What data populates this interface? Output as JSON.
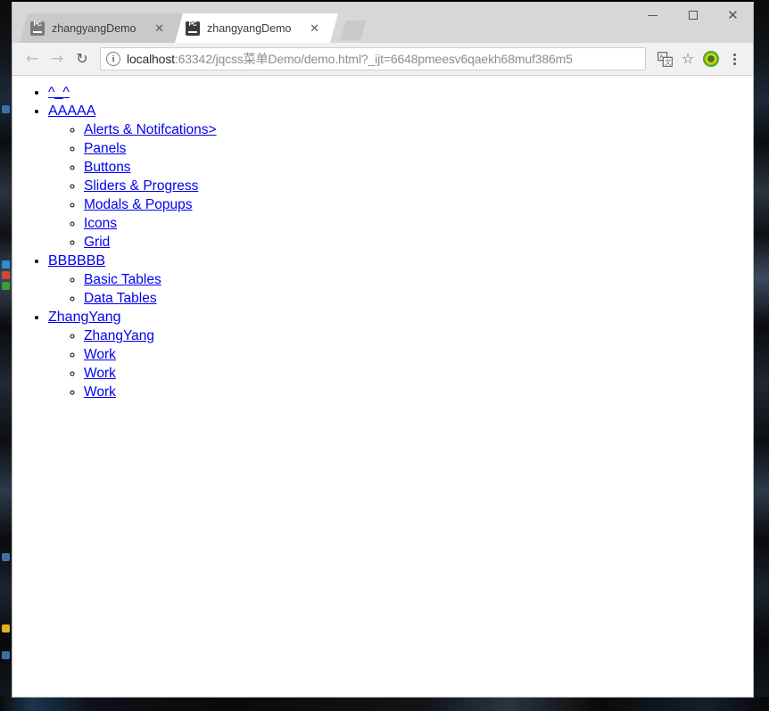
{
  "window": {
    "controls": {
      "minimize_label": "Minimize",
      "maximize_label": "Maximize",
      "close_label": "Close",
      "close_glyph": "✕"
    }
  },
  "tabstrip": {
    "tabs": [
      {
        "title": "zhangyangDemo",
        "favicon": "pycharm-icon",
        "close_glyph": "✕",
        "active": false
      },
      {
        "title": "zhangyangDemo",
        "favicon": "pycharm-icon",
        "close_glyph": "✕",
        "active": true
      }
    ],
    "new_tab_label": "New Tab"
  },
  "toolbar": {
    "back_glyph": "←",
    "forward_glyph": "→",
    "reload_glyph": "↻",
    "site_info_glyph": "i",
    "url_host": "localhost",
    "url_path": ":63342/jqcss菜单Demo/demo.html?_ijt=6648pmeesv6qaekh68muf386m5",
    "url_full": "localhost:63342/jqcss菜单Demo/demo.html?_ijt=6648pmeesv6qaekh68muf386m5",
    "translate_label": "Translate this page",
    "bookmark_glyph": "☆",
    "extension_label": "Extension",
    "menu_label": "Customize and control Google Chrome"
  },
  "page": {
    "menu": [
      {
        "label": "^_^",
        "children": []
      },
      {
        "label": "AAAAA",
        "children": [
          {
            "label": "Alerts & Notifcations>"
          },
          {
            "label": "Panels"
          },
          {
            "label": "Buttons"
          },
          {
            "label": "Sliders & Progress"
          },
          {
            "label": "Modals & Popups"
          },
          {
            "label": "Icons"
          },
          {
            "label": "Grid"
          }
        ]
      },
      {
        "label": "BBBBBB",
        "children": [
          {
            "label": "Basic Tables"
          },
          {
            "label": "Data Tables"
          }
        ]
      },
      {
        "label": "ZhangYang",
        "children": [
          {
            "label": "ZhangYang"
          },
          {
            "label": "Work"
          },
          {
            "label": "Work"
          },
          {
            "label": "Work"
          }
        ]
      }
    ]
  },
  "colors": {
    "link": "#0000EE",
    "tabstrip_bg": "#d7d7d7",
    "toolbar_bg": "#f1f1f1",
    "page_bg": "#ffffff"
  }
}
